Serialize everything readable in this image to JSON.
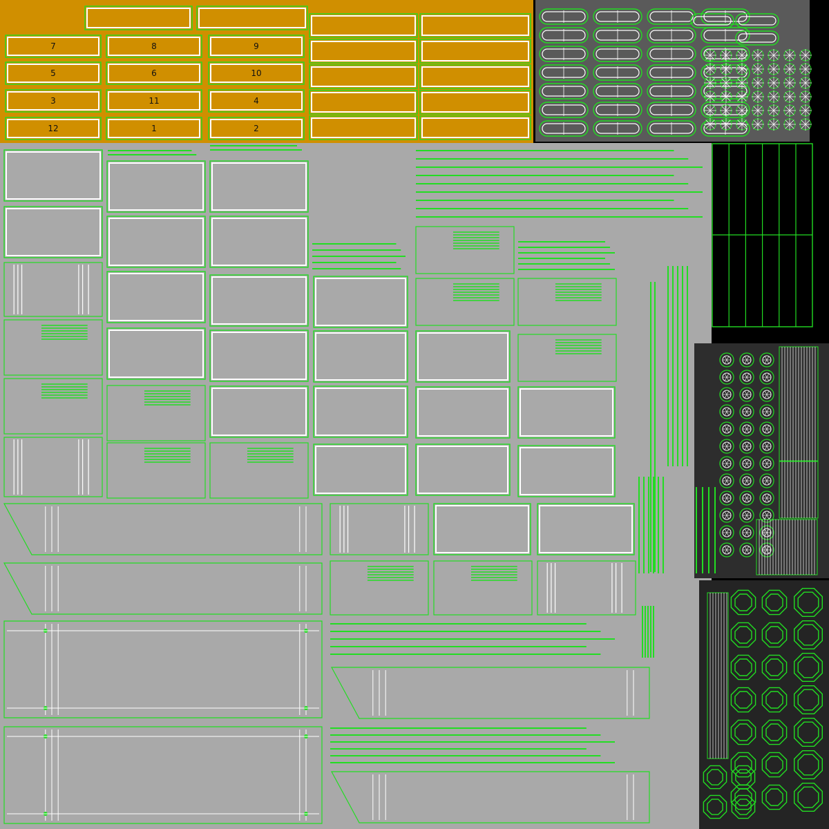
{
  "colors": {
    "background": "#000000",
    "orange_atlas": "#d08f00",
    "gray_atlas": "#a9a9a9",
    "dark_atlas": "#5a5a5a",
    "darker_atlas": "#2d2d2d",
    "wire_green": "#22dd22",
    "wire_white": "#ffffff"
  },
  "orange_panels": {
    "labels": [
      "7",
      "8",
      "9",
      "5",
      "6",
      "10",
      "3",
      "11",
      "4",
      "12",
      "1",
      "2"
    ]
  }
}
